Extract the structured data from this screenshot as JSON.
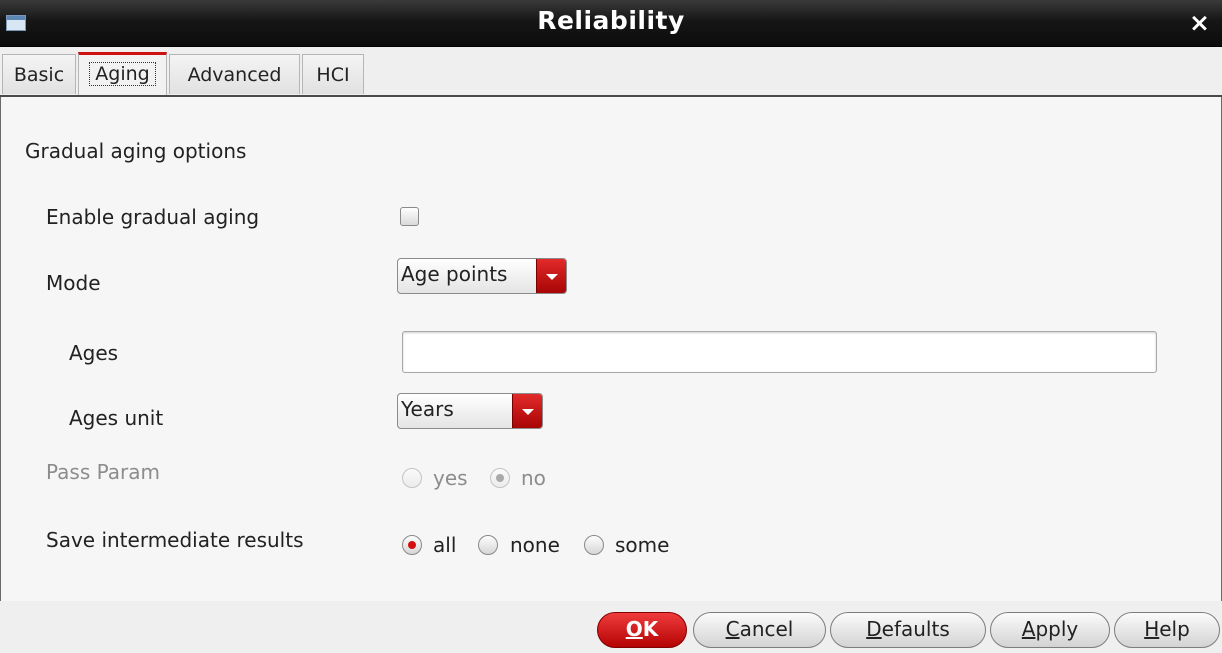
{
  "window": {
    "title": "Reliability",
    "close_glyph": "×",
    "icon": "app-window-icon"
  },
  "tabs": [
    {
      "label": "Basic"
    },
    {
      "label": "Aging",
      "active": true
    },
    {
      "label": "Advanced"
    },
    {
      "label": "HCI"
    }
  ],
  "section": {
    "title": "Gradual aging options"
  },
  "fields": {
    "enable_gradual_aging": {
      "label": "Enable gradual aging",
      "checked": false
    },
    "mode": {
      "label": "Mode",
      "value": "Age points"
    },
    "ages": {
      "label": "Ages",
      "value": "",
      "placeholder": ""
    },
    "ages_unit": {
      "label": "Ages unit",
      "value": "Years"
    },
    "pass_param": {
      "label": "Pass Param",
      "enabled": false,
      "options": [
        "yes",
        "no"
      ],
      "selected": "no"
    },
    "save_intermediate": {
      "label": "Save intermediate results",
      "options": [
        "all",
        "none",
        "some"
      ],
      "selected": "all"
    }
  },
  "buttons": {
    "ok": {
      "first": "O",
      "rest": "K"
    },
    "cancel": {
      "first": "C",
      "rest": "ancel"
    },
    "defaults": {
      "first": "D",
      "rest": "efaults"
    },
    "apply": {
      "first": "A",
      "rest": "pply"
    },
    "help": {
      "first": "H",
      "rest": "elp"
    }
  },
  "colors": {
    "accent": "#cf1010",
    "titlebar": "#161616"
  }
}
